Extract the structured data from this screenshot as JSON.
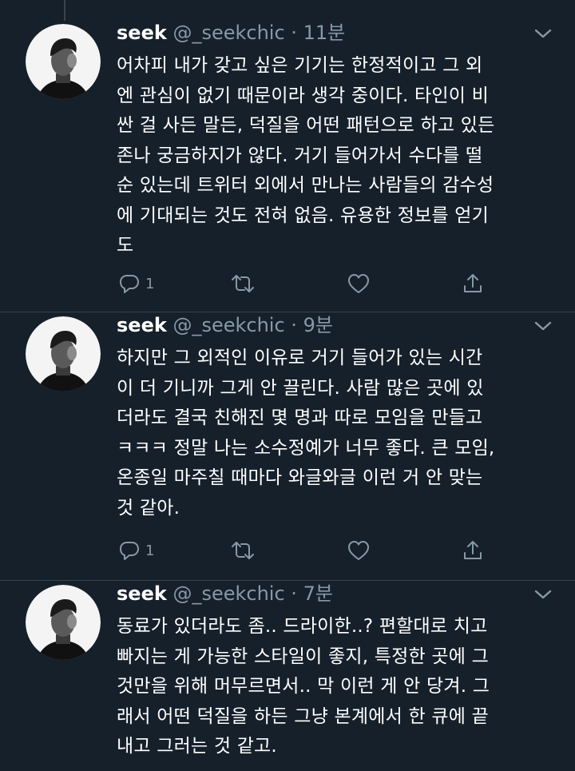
{
  "tweets": [
    {
      "name": "seek",
      "handle": "@_seekchic",
      "separator": "·",
      "time": "11분",
      "text": "어차피 내가 갖고 싶은 기기는 한정적이고 그 외\n엔 관심이 없기 때문이라 생각 중이다. 타인이 비\n싼 걸 사든 말든, 덕질을 어떤 패턴으로 하고 있든\n존나 궁금하지가 않다. 거기 들어가서 수다를 떨\n순 있는데 트위터 외에서 만나는 사람들의 감수성\n에 기대되는 것도 전혀 없음. 유용한 정보를 얻기\n도",
      "reply_count": "1",
      "icons": {
        "reply": "reply-icon",
        "retweet": "retweet-icon",
        "like": "heart-icon",
        "share": "share-icon",
        "menu": "chevron-down-icon"
      }
    },
    {
      "name": "seek",
      "handle": "@_seekchic",
      "separator": "·",
      "time": "9분",
      "text": "하지만 그 외적인 이유로 거기 들어가 있는 시간\n이 더 기니까 그게 안 끌린다. 사람 많은 곳에 있\n더라도 결국 친해진 몇 명과 따로 모임을 만들고\nㅋㅋㅋ 정말 나는 소수정예가 너무 좋다. 큰 모임,\n온종일 마주칠 때마다 와글와글 이런 거 안 맞는\n것 같아.",
      "reply_count": "1",
      "icons": {
        "reply": "reply-icon",
        "retweet": "retweet-icon",
        "like": "heart-icon",
        "share": "share-icon",
        "menu": "chevron-down-icon"
      }
    },
    {
      "name": "seek",
      "handle": "@_seekchic",
      "separator": "·",
      "time": "7분",
      "text": "동료가 있더라도 좀.. 드라이한..? 편할대로 치고\n빠지는 게 가능한 스타일이 좋지, 특정한 곳에 그\n것만을 위해 머무르면서.. 막 이런 게 안 당겨. 그\n래서 어떤 덕질을 하든 그냥 본계에서 한 큐에 끝\n내고 그러는 것 같고.",
      "icons": {
        "menu": "chevron-down-icon"
      }
    }
  ],
  "colors": {
    "background": "#15202b",
    "text": "#ffffff",
    "secondary": "#8899a6",
    "divider": "#38444d"
  }
}
